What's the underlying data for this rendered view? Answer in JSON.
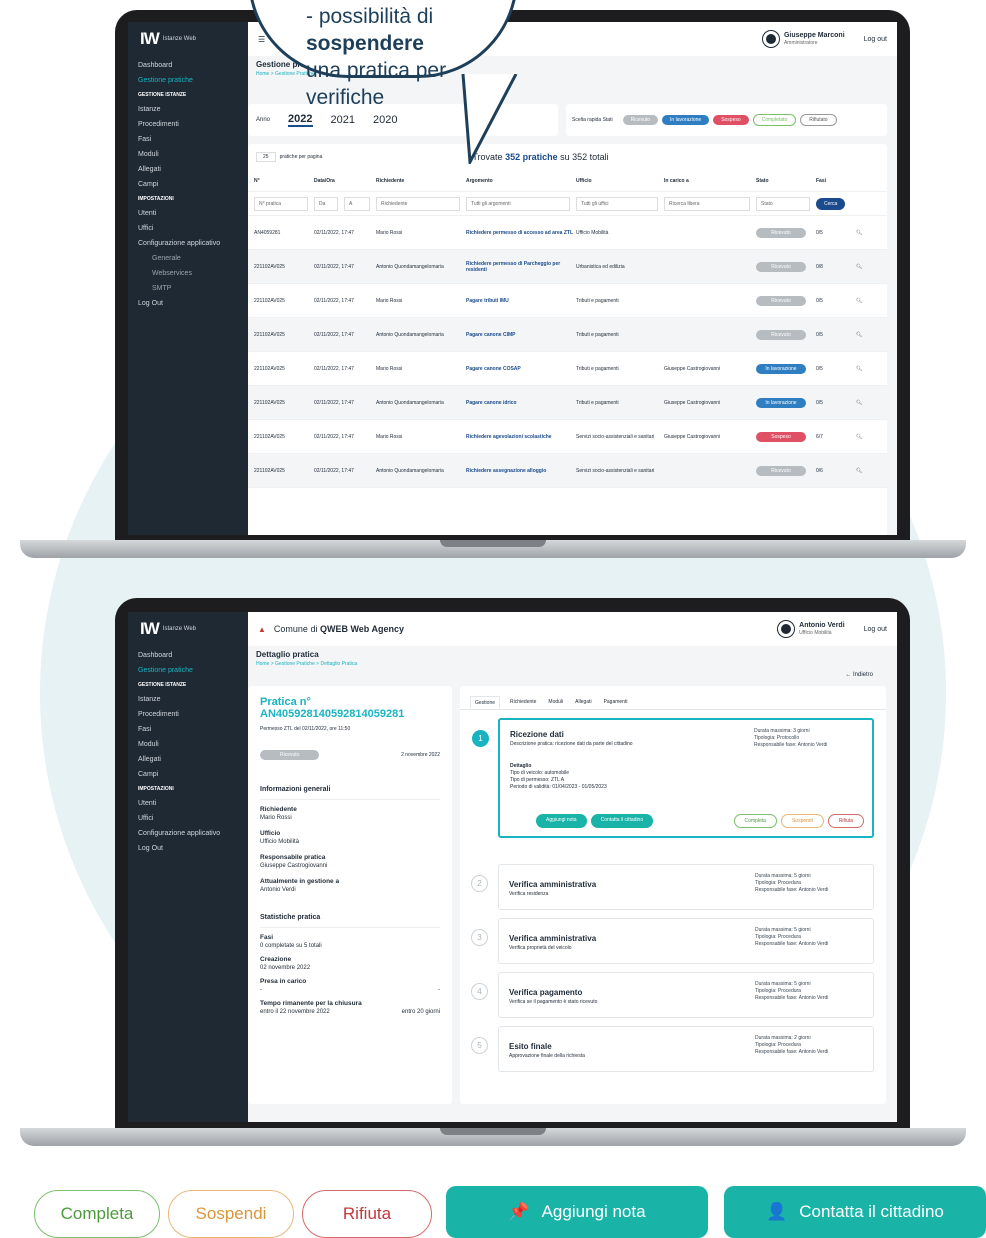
{
  "callout": {
    "line1_prefix": "- possibilità di ",
    "line1_bold": "sospendere",
    "line2": "una pratica per verifiche"
  },
  "app": {
    "logo": "IW",
    "logo_sub": "Istanze Web"
  },
  "sidebar": {
    "items": [
      "Dashboard",
      "Gestione pratiche",
      "GESTIONE ISTANZE",
      "Istanze",
      "Procedimenti",
      "Fasi",
      "Moduli",
      "Allegati",
      "Campi",
      "IMPOSTAZIONI",
      "Utenti",
      "Uffici",
      "Configurazione applicativo",
      "Generale",
      "Webservices",
      "SMTP",
      "Log Out"
    ]
  },
  "top": {
    "user": "Giuseppe Marconi",
    "role": "Amministratore",
    "logout": "Log out",
    "title": "Gestione pratiche",
    "breadcrumb": "Home  >  Gestione Pratiche",
    "anno_label": "Anno",
    "years": [
      "2022",
      "2021",
      "2020"
    ],
    "states_label": "Scelta rapida Stati",
    "states": [
      "Ricevuto",
      "In lavorazione",
      "Sospeso",
      "Completato",
      "Rifiutato"
    ],
    "per_page": "25",
    "per_page_label": "pratiche per pagina",
    "found_pre": "Trovate ",
    "found_bold": "352 pratiche",
    "found_post": " su 352 totali",
    "cols": [
      "N°",
      "Data/Ora",
      "Richiedente",
      "Argomento",
      "Ufficio",
      "In carico a",
      "Stato",
      "Fasi"
    ],
    "filters": [
      "N° pratica",
      "Da",
      "A",
      "Richiedente",
      "Tutti gli argomenti",
      "Tutti gli uffici",
      "Ricerca libera",
      "Stato"
    ],
    "search": "Cerca",
    "reset": "Reset filtri",
    "rows": [
      [
        "AN4059281",
        "02/11/2022, 17:47",
        "Mario Rossi",
        "Richiedere permesso di accesso ad area ZTL",
        "Ufficio Mobilità",
        "",
        "Ricevuto",
        "0/5"
      ],
      [
        "221102AV025",
        "02/11/2022, 17:47",
        "Antonio Quondamangelomaria",
        "Richiedere permesso di Parcheggio per residenti",
        "Urbanistica ed edilizia",
        "",
        "Ricevuto",
        "0/8"
      ],
      [
        "221102AV025",
        "02/11/2022, 17:47",
        "Mario Rossi",
        "Pagare tributi IMU",
        "Tributi e pagamenti",
        "",
        "Ricevuto",
        "0/5"
      ],
      [
        "221102AV025",
        "02/11/2022, 17:47",
        "Antonio Quondamangelomaria",
        "Pagare canone CIMP",
        "Tributi e pagamenti",
        "",
        "Ricevuto",
        "0/5"
      ],
      [
        "221102AV025",
        "02/11/2022, 17:47",
        "Mario Rossi",
        "Pagare canone COSAP",
        "Tributi e pagamenti",
        "Giuseppe Castrogiovanni",
        "In lavorazione",
        "0/5"
      ],
      [
        "221102AV025",
        "02/11/2022, 17:47",
        "Antonio Quondamangelomaria",
        "Pagare canone idrico",
        "Tributi e pagamenti",
        "Giuseppe Castrogiovanni",
        "In lavorazione",
        "0/5"
      ],
      [
        "221102AV025",
        "02/11/2022, 17:47",
        "Mario Rossi",
        "Richiedere agevolazioni scolastiche",
        "Servizi socio-assistenziali e sanitari",
        "Giuseppe Castrogiovanni",
        "Sospeso",
        "6/7"
      ],
      [
        "221102AV025",
        "02/11/2022, 17:47",
        "Antonio Quondamangelomaria",
        "Richiedere assegnazione alloggio",
        "Servizi socio-assistenziali e sanitari",
        "",
        "Ricevuto",
        "0/6"
      ]
    ]
  },
  "bottom": {
    "org_pre": "Comune di ",
    "org_bold": "QWEB Web Agency",
    "user": "Antonio Verdi",
    "role": "Ufficio Mobilità",
    "logout": "Log out",
    "title": "Dettaglio pratica",
    "breadcrumb": "Home  >  Gestione Pratiche  >  Dettaglio Pratica",
    "back": "Indietro",
    "pratica_label": "Pratica n°",
    "pratica_id": "AN405928140592814059281",
    "permesso": "Permesso ZTL del 02/11/2022, ore 11:50",
    "status": "Ricevuto",
    "date": "2 novembre 2022",
    "info_title": "Informazioni generali",
    "info": [
      [
        "Richiedente",
        "Mario Rossi"
      ],
      [
        "Ufficio",
        "Ufficio Mobilità"
      ],
      [
        "Responsabile pratica",
        "Giuseppe Castrogiovanni"
      ],
      [
        "Attualmente in gestione a",
        "Antonio Verdi"
      ]
    ],
    "stats_title": "Statistiche pratica",
    "stats": [
      [
        "Fasi",
        "0 completate su 5 totali",
        ""
      ],
      [
        "Creazione",
        "02 novembre 2022",
        ""
      ],
      [
        "Presa in carico",
        "-",
        "-"
      ],
      [
        "Tempo rimanente per la chiusura",
        "entro il 22 novembre 2022",
        "entro 20 giorni"
      ]
    ],
    "tabs": [
      "Gestione",
      "Richiedente",
      "Moduli",
      "Allegati",
      "Pagamenti"
    ],
    "phases": [
      {
        "n": "1",
        "title": "Ricezione dati",
        "desc": "Descrizione pratica: ricezione dati da parte del cittadino",
        "meta": [
          "Durata massima: 3 giorni",
          "Tipologia: Protocollo",
          "Responsabile fase: Antonio Verdi"
        ]
      },
      {
        "n": "2",
        "title": "Verifica amministrativa",
        "desc": "Verifica residenza",
        "meta": [
          "Durata massima: 5 giorni",
          "Tipologia: Procedura",
          "Responsabile fase: Antonio Verdi"
        ]
      },
      {
        "n": "3",
        "title": "Verifica amministrativa",
        "desc": "Verifica proprietà del veicolo",
        "meta": [
          "Durata massima: 5 giorni",
          "Tipologia: Procedura",
          "Responsabile fase: Antonio Verdi"
        ]
      },
      {
        "n": "4",
        "title": "Verifica pagamento",
        "desc": "Verifica se il pagamento è stato ricevuto",
        "meta": [
          "Durata massima: 5 giorni",
          "Tipologia: Procedura",
          "Responsabile fase: Antonio Verdi"
        ]
      },
      {
        "n": "5",
        "title": "Esito finale",
        "desc": "Approvazione finale della richiesta",
        "meta": [
          "Durata massima: 2 giorni",
          "Tipologia: Procedura",
          "Responsabile fase: Antonio Verdi"
        ]
      }
    ],
    "dettaglio": [
      "Dettaglio",
      "Tipo di veicolo: automobile",
      "Tipo di permesso: ZTL A",
      "Periodo di validità: 01/04/2023 - 01/05/2023"
    ],
    "mini_actions": [
      "Aggiungi nota",
      "Contatta il cittadino",
      "Completa",
      "Sospendi",
      "Rifiuta"
    ]
  },
  "actions": {
    "completa": "Completa",
    "sospendi": "Sospendi",
    "rifiuta": "Rifiuta",
    "nota": "Aggiungi nota",
    "contatta": "Contatta il cittadino"
  },
  "colors": {
    "accent": "#19b3c1",
    "ricevuto": "#b7bcc1",
    "lavorazione": "#2f7ec1",
    "sospeso": "#e05064",
    "completa": "#7bbf6a",
    "sospendi": "#e7b879",
    "rifiuta": "#d46a6a"
  }
}
